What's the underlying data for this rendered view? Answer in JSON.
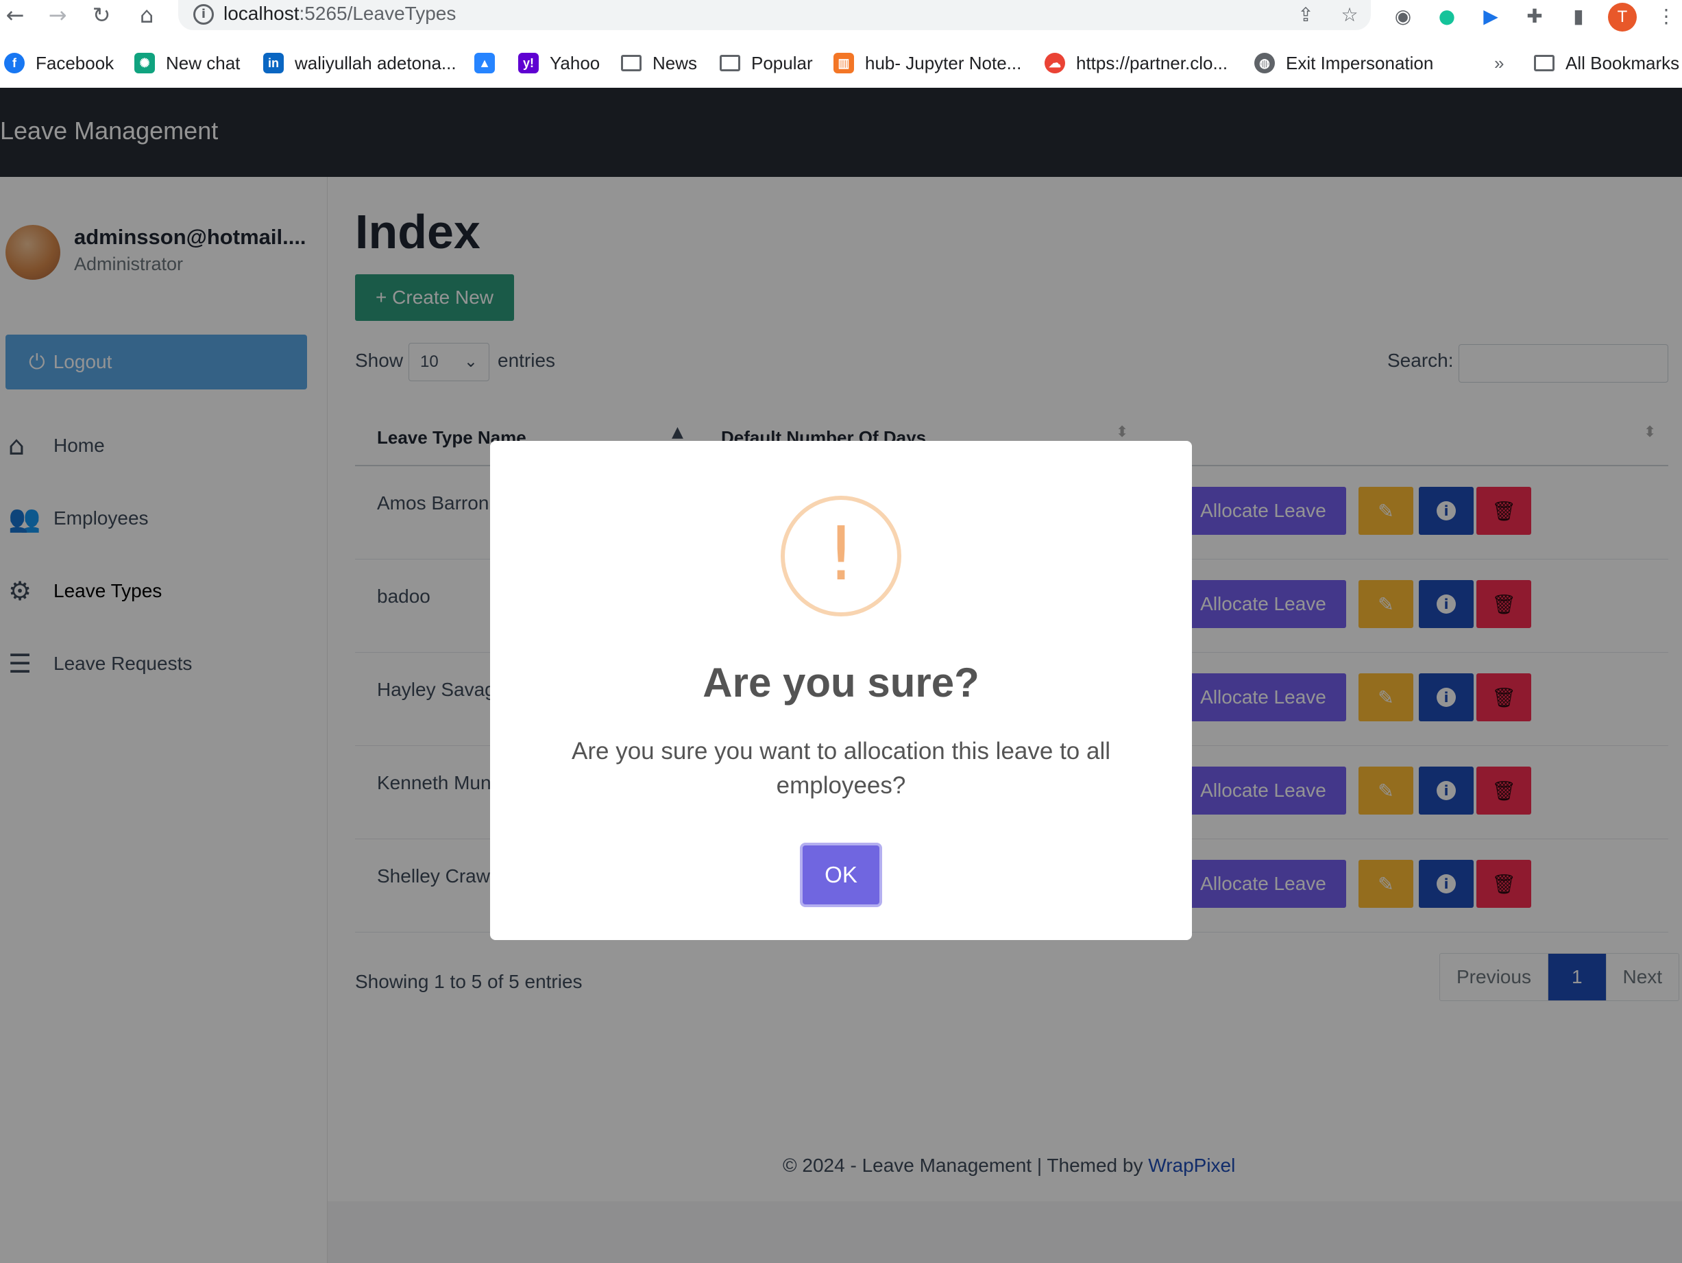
{
  "browser": {
    "url_host": "localhost",
    "url_path": ":5265/LeaveTypes",
    "profile_initial": "T",
    "bookmarks": [
      {
        "label": "Facebook",
        "icon": "facebook-icon"
      },
      {
        "label": "New chat",
        "icon": "chatgpt-icon"
      },
      {
        "label": "waliyullah adetona...",
        "icon": "linkedin-icon"
      },
      {
        "label": "",
        "icon": "atlassian-icon"
      },
      {
        "label": "Yahoo",
        "icon": "yahoo-icon"
      },
      {
        "label": "News",
        "icon": "folder-icon"
      },
      {
        "label": "Popular",
        "icon": "folder-icon"
      },
      {
        "label": "hub- Jupyter Note...",
        "icon": "jupyter-icon"
      },
      {
        "label": "https://partner.clo...",
        "icon": "google-cloud-icon"
      },
      {
        "label": "Exit Impersonation",
        "icon": "globe-icon"
      }
    ],
    "more_bookmarks": "»",
    "all_bookmarks": "All Bookmarks"
  },
  "app": {
    "brand": "Leave Management",
    "user": {
      "name": "adminsson@hotmail....",
      "role": "Administrator"
    },
    "logout_label": "Logout",
    "sidebar": [
      {
        "label": "Home",
        "icon": "home-icon"
      },
      {
        "label": "Employees",
        "icon": "users-icon"
      },
      {
        "label": "Leave Types",
        "icon": "gears-icon"
      },
      {
        "label": "Leave Requests",
        "icon": "list-check-icon"
      }
    ]
  },
  "page": {
    "title": "Index",
    "create_label": "+ Create New",
    "show_label": "Show",
    "page_length": "10",
    "entries_label": "entries",
    "search_label": "Search:",
    "search_value": "",
    "columns": [
      "Leave Type Name",
      "Default Number Of Days"
    ],
    "rows": [
      {
        "name": "Amos Barron"
      },
      {
        "name": "badoo"
      },
      {
        "name": "Hayley Savag"
      },
      {
        "name": "Kenneth Mun"
      },
      {
        "name": "Shelley Craw"
      }
    ],
    "allocate_label": "Allocate Leave",
    "showing_text": "Showing 1 to 5 of 5 entries",
    "pagination": {
      "previous": "Previous",
      "current": "1",
      "next": "Next"
    },
    "footer_text": "© 2024 - Leave Management | Themed by",
    "footer_link": "WrapPixel"
  },
  "modal": {
    "icon": "warning-icon",
    "icon_glyph": "!",
    "title": "Are you sure?",
    "text": "Are you sure you want to allocation this leave to all employees?",
    "ok_label": "OK"
  },
  "colors": {
    "topbar": "#262b35",
    "create": "#2e9b7d",
    "allocate": "#7460ee",
    "edit": "#ffbc34",
    "info": "#1e4db7",
    "delete": "#f62d51",
    "ok": "#7066e0",
    "warning": "#f8bb86"
  }
}
